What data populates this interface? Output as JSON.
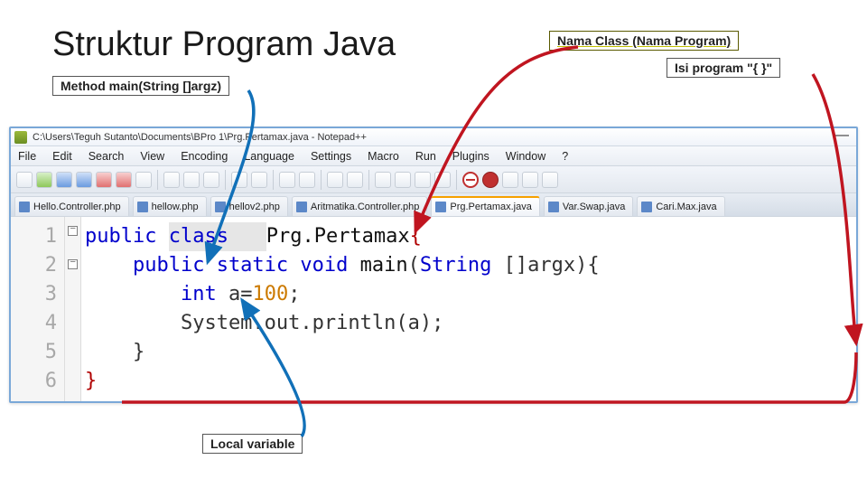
{
  "slide_title": "Struktur Program Java",
  "annotations": {
    "method": "Method main(String []argz)",
    "class": "Nama Class (Nama Program)",
    "isi": "Isi program \"{ }\"",
    "local": "Local variable"
  },
  "window": {
    "title": "C:\\Users\\Teguh Sutanto\\Documents\\BPro 1\\Prg.Pertamax.java - Notepad++"
  },
  "menus": [
    "File",
    "Edit",
    "Search",
    "View",
    "Encoding",
    "Language",
    "Settings",
    "Macro",
    "Run",
    "Plugins",
    "Window",
    "?"
  ],
  "tabs": [
    {
      "label": "Hello.Controller.php",
      "type": "php",
      "active": false
    },
    {
      "label": "hellow.php",
      "type": "php",
      "active": false
    },
    {
      "label": "hellov2.php",
      "type": "php",
      "active": false
    },
    {
      "label": "Aritmatika.Controller.php",
      "type": "php",
      "active": false
    },
    {
      "label": "Prg.Pertamax.java",
      "type": "java",
      "active": true
    },
    {
      "label": "Var.Swap.java",
      "type": "java",
      "active": false
    },
    {
      "label": "Cari.Max.java",
      "type": "java",
      "active": false
    }
  ],
  "gutter": [
    "1",
    "2",
    "3",
    "4",
    "5",
    "6"
  ],
  "code": {
    "l1_public": "public ",
    "l1_class": "class ",
    "l1_name": "Prg.Pertamax",
    "l1_brace": "{",
    "l2": "    public static void ",
    "l2_main": "main",
    "l2_open": "(",
    "l2_type": "String ",
    "l2_arg": "[]argx",
    "l2_close": ")",
    "l2_brace": "{",
    "l3_indent": "        ",
    "l3_type": "int ",
    "l3_var": "a=",
    "l3_num": "100",
    "l3_semi": ";",
    "l4": "        System.out.println(a);",
    "l5": "    }",
    "l6": "}"
  }
}
